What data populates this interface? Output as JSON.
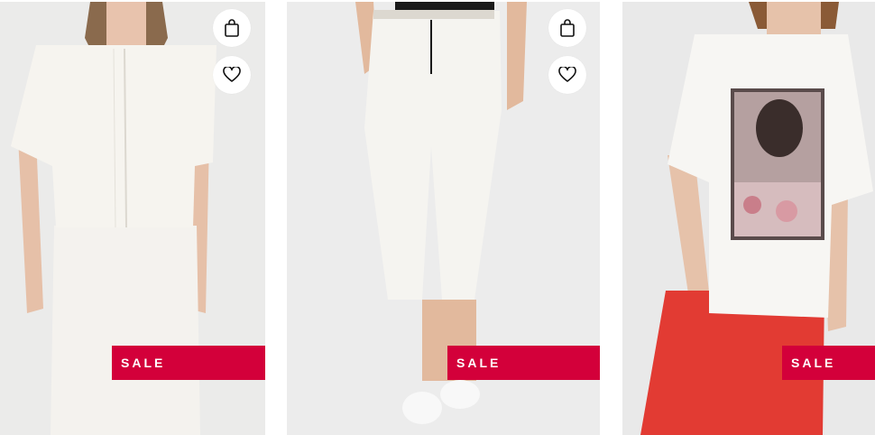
{
  "products": [
    {
      "image_desc": "model-white-jacket-and-skirt",
      "sale_label": "SALE",
      "actions": {
        "bag_icon": "shopping-bag-icon",
        "wishlist_icon": "heart-icon"
      }
    },
    {
      "image_desc": "model-white-cropped-trousers",
      "sale_label": "SALE",
      "actions": {
        "bag_icon": "shopping-bag-icon",
        "wishlist_icon": "heart-icon"
      }
    },
    {
      "image_desc": "model-white-print-tshirt-red-jeans",
      "sale_label": "SALE"
    }
  ],
  "colors": {
    "sale_badge_bg": "#d3003a",
    "card_bg": "#ececec",
    "garment_white": "#f6f4ef",
    "jeans_red": "#e23b33"
  }
}
